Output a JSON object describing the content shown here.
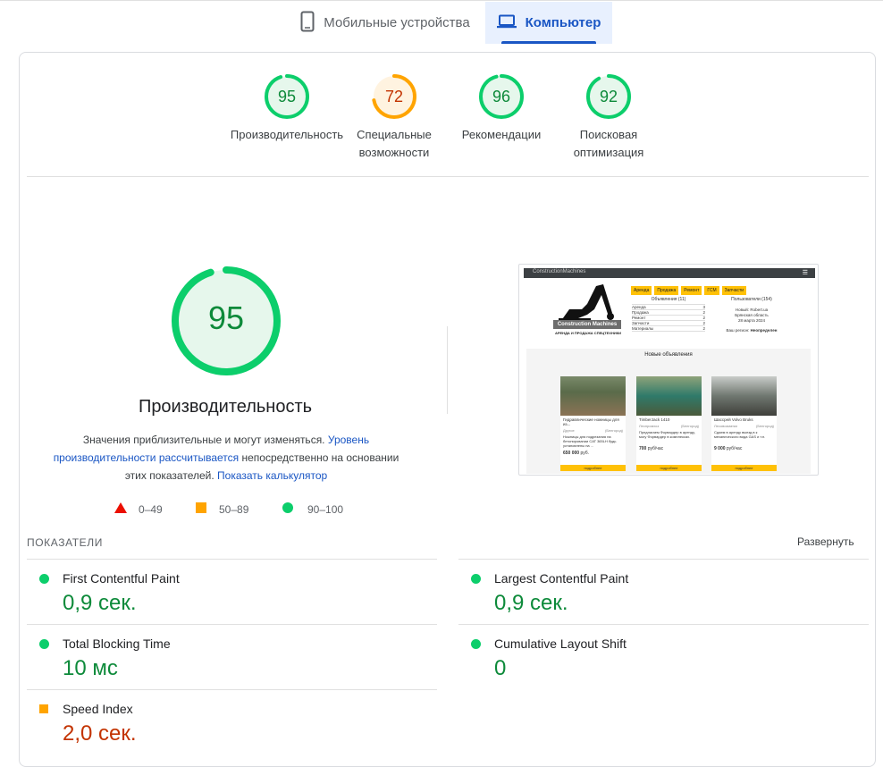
{
  "tabs": {
    "mobile_label": "Мобильные устройства",
    "desktop_label": "Компьютер"
  },
  "scores": [
    {
      "value": 95,
      "label1": "Производительность",
      "label2": "",
      "status": "good",
      "color": "#0cce6b"
    },
    {
      "value": 72,
      "label1": "Специальные",
      "label2": "возможности",
      "status": "average",
      "color": "#ffa400"
    },
    {
      "value": 96,
      "label1": "Рекомендации",
      "label2": "",
      "status": "good",
      "color": "#0cce6b"
    },
    {
      "value": 92,
      "label1": "Поисковая",
      "label2": "оптимизация",
      "status": "good",
      "color": "#0cce6b"
    }
  ],
  "performance": {
    "score": 95,
    "title": "Производительность",
    "desc_part1": "Значения приблизительные и могут изменяться.",
    "link1": "Уровень производительности рассчитывается",
    "desc_part2": "непосредственно на основании этих показателей.",
    "link2": "Показать калькулятор"
  },
  "legend": {
    "poor": "0–49",
    "average": "50–89",
    "good": "90–100"
  },
  "preview": {
    "site_name": "ConstructionMachines",
    "logo_text": "Construction Machines",
    "logo_sub": "АРЕНДА И ПРОДАЖА СПЕЦТЕХНИКИ",
    "nav": [
      "Аренда",
      "Продажа",
      "Ремонт",
      "ГСМ",
      "Запчасти"
    ],
    "ads_title": "Объявления (11)",
    "ads_list": [
      {
        "name": "Аренда",
        "count": "3"
      },
      {
        "name": "Продажа",
        "count": "2"
      },
      {
        "name": "Ремонт",
        "count": "2"
      },
      {
        "name": "Запчасти",
        "count": "2"
      },
      {
        "name": "Материалы",
        "count": "2"
      }
    ],
    "users_title": "Пользователи (154)",
    "users_line1": "Новый: Robert.ua",
    "users_line2": "Брянская область",
    "users_line3": "28 марта 2024",
    "region_label": "Ваш регион:",
    "region_value": "Неопределен",
    "new_ads_title": "Новые объявления",
    "cards": [
      {
        "title": "Гидравлические ножницы для из...",
        "category": "Другое",
        "condition": "(Белгород)",
        "desc": "Ножницы для подрезания на бетонировании CAT 365LH будь установлены на ...",
        "price": "650 000",
        "unit": "руб.",
        "button": "подробнее"
      },
      {
        "title": "TimberJack 1410",
        "category": "Леспромхоз",
        "condition": "(Белгород)",
        "desc": "Предлагаем Форвардер в аренду, могу Форвардер в комплексах.",
        "price": "700",
        "unit": "руб/час",
        "button": "подробнее"
      },
      {
        "title": "Шасcрей Volvo Bruks",
        "category": "Лесовозматки",
        "condition": "(Белгород)",
        "desc": "Сдаем в аренду выезд в к механического вида GAS и т.п.",
        "price": "9 000",
        "unit": "руб/час",
        "button": "подробнее"
      }
    ]
  },
  "metrics": {
    "section_title": "ПОКАЗАТЕЛИ",
    "expand_label": "Развернуть",
    "items": [
      {
        "name": "First Contentful Paint",
        "value": "0,9 сек.",
        "status": "good"
      },
      {
        "name": "Largest Contentful Paint",
        "value": "0,9 сек.",
        "status": "good"
      },
      {
        "name": "Total Blocking Time",
        "value": "10 мс",
        "status": "good"
      },
      {
        "name": "Cumulative Layout Shift",
        "value": "0",
        "status": "good"
      },
      {
        "name": "Speed Index",
        "value": "2,0 сек.",
        "status": "average"
      }
    ]
  },
  "colors": {
    "good": "#0cce6b",
    "average": "#ffa400",
    "poor": "#ff4e42",
    "accent": "#1a56c4"
  }
}
